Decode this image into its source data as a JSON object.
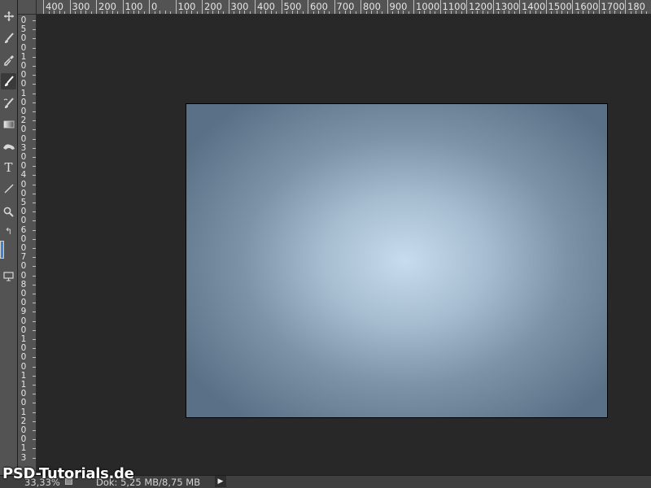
{
  "rulers": {
    "horizontal_labels": [
      "400",
      "300",
      "200",
      "100",
      "0",
      "100",
      "200",
      "300",
      "400",
      "500",
      "600",
      "700",
      "800",
      "900",
      "1000",
      "1100",
      "1200",
      "1300",
      "1400",
      "1500",
      "1600",
      "1700",
      "180"
    ],
    "vertical_labels": [
      "0",
      "5",
      "0",
      "0",
      "1",
      "0",
      "0",
      "0",
      "1",
      "0",
      "0",
      "2",
      "0",
      "0",
      "3",
      "0",
      "0",
      "4",
      "0",
      "0",
      "5",
      "0",
      "0",
      "6",
      "0",
      "0",
      "7",
      "0",
      "0",
      "8",
      "0",
      "0",
      "9",
      "0",
      "0",
      "1",
      "0",
      "0",
      "0",
      "1",
      "1",
      "0",
      "0",
      "1",
      "2",
      "0",
      "0",
      "1",
      "3"
    ]
  },
  "tools": [
    {
      "name": "move-tool-icon",
      "glyph": "✥"
    },
    {
      "name": "brush-tool-icon",
      "glyph": "brush"
    },
    {
      "name": "eyedropper-tool-icon",
      "glyph": "dropper"
    },
    {
      "name": "brush-tool-active-icon",
      "glyph": "brush",
      "active": true
    },
    {
      "name": "history-brush-tool-icon",
      "glyph": "hbrush"
    },
    {
      "name": "gradient-tool-icon",
      "glyph": "gradient"
    },
    {
      "name": "smudge-tool-icon",
      "glyph": "smudge"
    },
    {
      "name": "type-tool-icon",
      "glyph": "T"
    },
    {
      "name": "line-tool-icon",
      "glyph": "line"
    },
    {
      "name": "zoom-tool-icon",
      "glyph": "zoom"
    },
    {
      "name": "swap-colors-icon",
      "glyph": "↰"
    }
  ],
  "colors": {
    "foreground": "#3a84d4",
    "canvas_center": "#c7dcee",
    "canvas_edge": "#5a7086"
  },
  "status": {
    "zoom": "33,33%",
    "doc_size": "Dok: 5,25 MB/8,75 MB",
    "arrow": "▶"
  },
  "watermark": "PSD-Tutorials.de"
}
